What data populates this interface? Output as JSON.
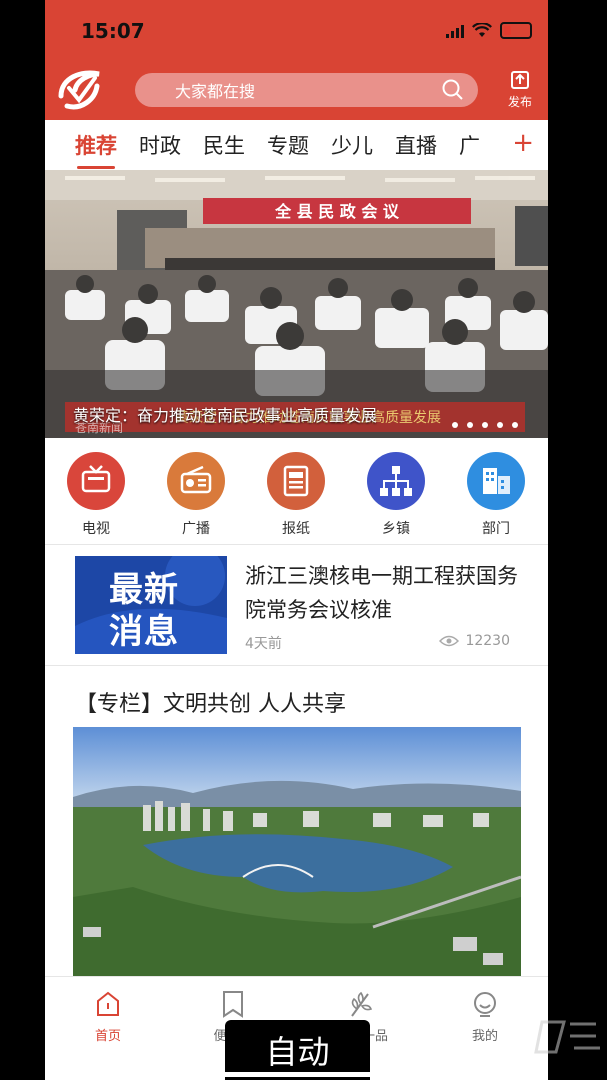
{
  "status_bar": {
    "time": "15:07"
  },
  "header": {
    "search_placeholder": "大家都在搜",
    "publish_label": "发布"
  },
  "tabs": [
    {
      "label": "推荐"
    },
    {
      "label": "时政"
    },
    {
      "label": "民生"
    },
    {
      "label": "专题"
    },
    {
      "label": "少儿"
    },
    {
      "label": "直播"
    },
    {
      "label": "广"
    }
  ],
  "tab_add_label": "+",
  "banner": {
    "caption": "黄荣定：奋力推动苍南民政事业高质量发展",
    "hall_banner_text": "全 县 民 政 会 议",
    "lower_third_text": "黄荣定：奋力推动苍南民政事业高质量发展",
    "channel_logo": "苍南新闻"
  },
  "channels": [
    {
      "label": "电视",
      "icon": "tv-icon",
      "color": "#d9463b"
    },
    {
      "label": "广播",
      "icon": "radio-icon",
      "color": "#d97a3b"
    },
    {
      "label": "报纸",
      "icon": "newspaper-icon",
      "color": "#d2603c"
    },
    {
      "label": "乡镇",
      "icon": "org-chart-icon",
      "color": "#3f54c9"
    },
    {
      "label": "部门",
      "icon": "building-icon",
      "color": "#2f8ee0"
    }
  ],
  "news": {
    "thumb_line1": "最新",
    "thumb_line2": "消息",
    "title": "浙江三澳核电一期工程获国务院常务会议核准",
    "time": "4天前",
    "views": "12230"
  },
  "column": {
    "title": "【专栏】文明共创  人人共享"
  },
  "bottom_nav": [
    {
      "label": "首页",
      "icon": "home-icon",
      "active": true
    },
    {
      "label": "便民服",
      "icon": "bookmark-icon",
      "active": false
    },
    {
      "label": "一品",
      "icon": "leaf-icon",
      "active": false
    },
    {
      "label": "我的",
      "icon": "profile-icon",
      "active": false
    }
  ],
  "overlay": {
    "auto_label": "自动"
  },
  "colors": {
    "brand_red": "#d94434",
    "search_bg": "#e9918b"
  }
}
